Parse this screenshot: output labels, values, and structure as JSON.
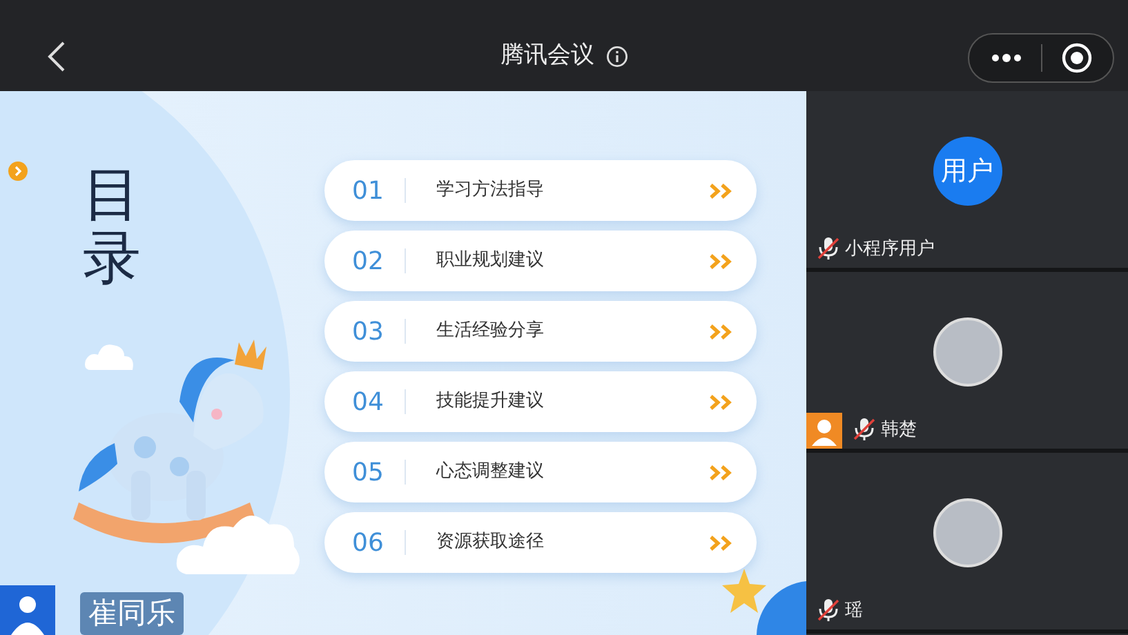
{
  "window": {
    "title": "腾讯会议"
  },
  "slide": {
    "title": "目录",
    "items": [
      {
        "number": "01",
        "label": "学习方法指导"
      },
      {
        "number": "02",
        "label": "职业规划建议"
      },
      {
        "number": "03",
        "label": "生活经验分享"
      },
      {
        "number": "04",
        "label": "技能提升建议"
      },
      {
        "number": "05",
        "label": "心态调整建议"
      },
      {
        "number": "06",
        "label": "资源获取途径"
      }
    ],
    "presenter": {
      "name": "崔同乐"
    }
  },
  "participants": [
    {
      "kind": "text",
      "avatar_text": "用户",
      "name": "小程序用户",
      "muted": true,
      "badge": false
    },
    {
      "kind": "photo",
      "name": "韩楚",
      "muted": true,
      "badge": true
    },
    {
      "kind": "photo",
      "name": "瑶",
      "muted": true,
      "badge": false
    }
  ]
}
